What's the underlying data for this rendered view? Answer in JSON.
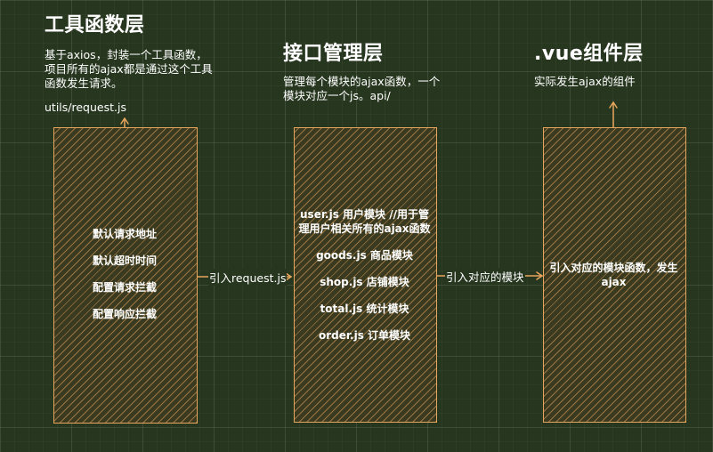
{
  "layers": {
    "tool": {
      "title": "工具函数层",
      "desc": "基于axios，封装一个工具函数，项目所有的ajax都是通过这个工具函数发生请求。",
      "file": "utils/request.js",
      "items": [
        "默认请求地址",
        "默认超时时间",
        "配置请求拦截",
        "配置响应拦截"
      ]
    },
    "api": {
      "title": "接口管理层",
      "desc": "管理每个模块的ajax函数，一个模块对应一个js。api/",
      "items": [
        "user.js 用户模块 //用于管理用户相关所有的ajax函数",
        "goods.js 商品模块",
        "shop.js 店铺模块",
        "total.js 统计模块",
        "order.js 订单模块"
      ]
    },
    "vue": {
      "title": ".vue组件层",
      "desc": "实际发生ajax的组件",
      "items": [
        "引入对应的模块函数，发生ajax"
      ]
    }
  },
  "arrows": {
    "tool_to_api": "引入request.js",
    "api_to_vue": "引入对应的模块"
  },
  "colors": {
    "accent": "#e8a65d",
    "background": "#27361f"
  }
}
